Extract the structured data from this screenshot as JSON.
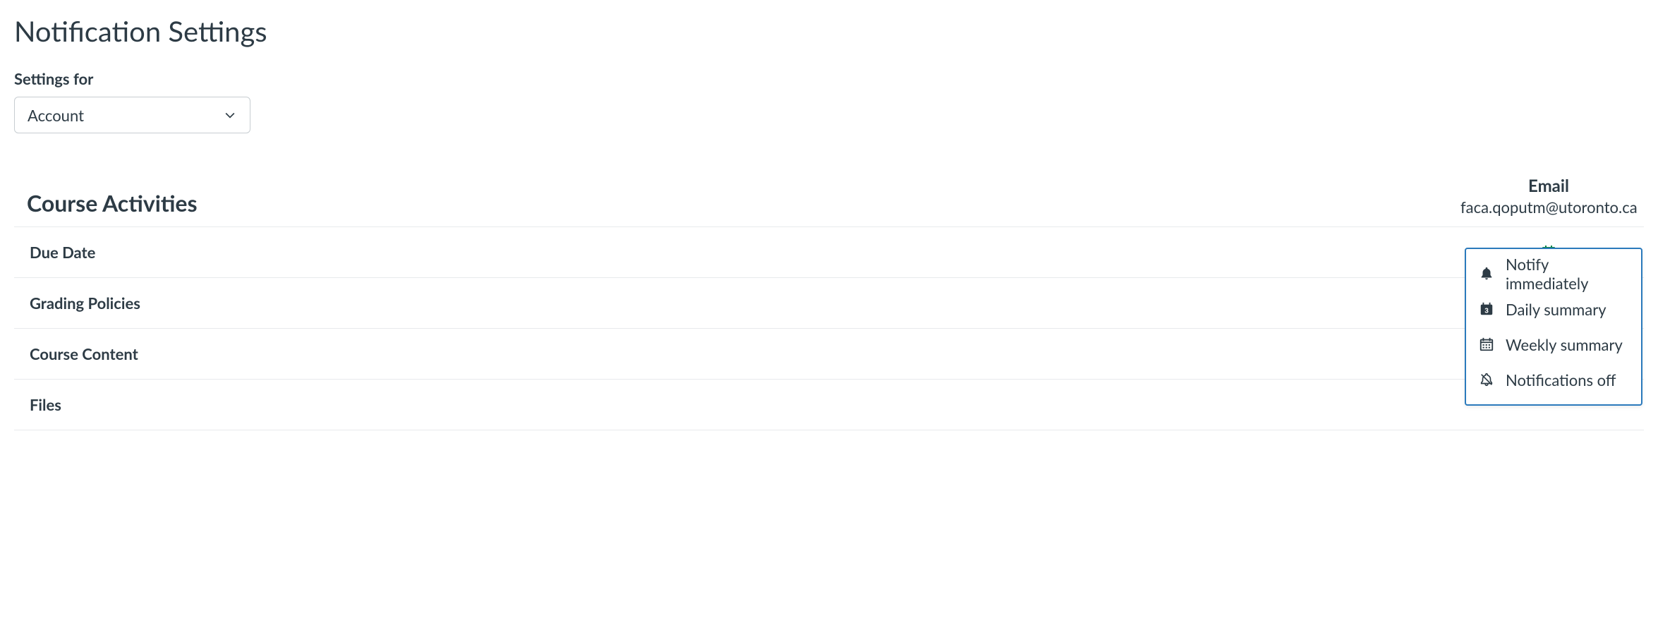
{
  "page": {
    "title": "Notification Settings",
    "settings_for_label": "Settings for",
    "account_select_value": "Account"
  },
  "section": {
    "title": "Course Activities"
  },
  "email_column": {
    "label": "Email",
    "address": "faca.qoputm@utoronto.ca"
  },
  "rows": {
    "due_date": "Due Date",
    "grading_policies": "Grading Policies",
    "course_content": "Course Content",
    "files": "Files"
  },
  "frequency_menu": {
    "immediately": "Notify immediately",
    "daily": "Daily summary",
    "weekly": "Weekly summary",
    "off": "Notifications off"
  }
}
